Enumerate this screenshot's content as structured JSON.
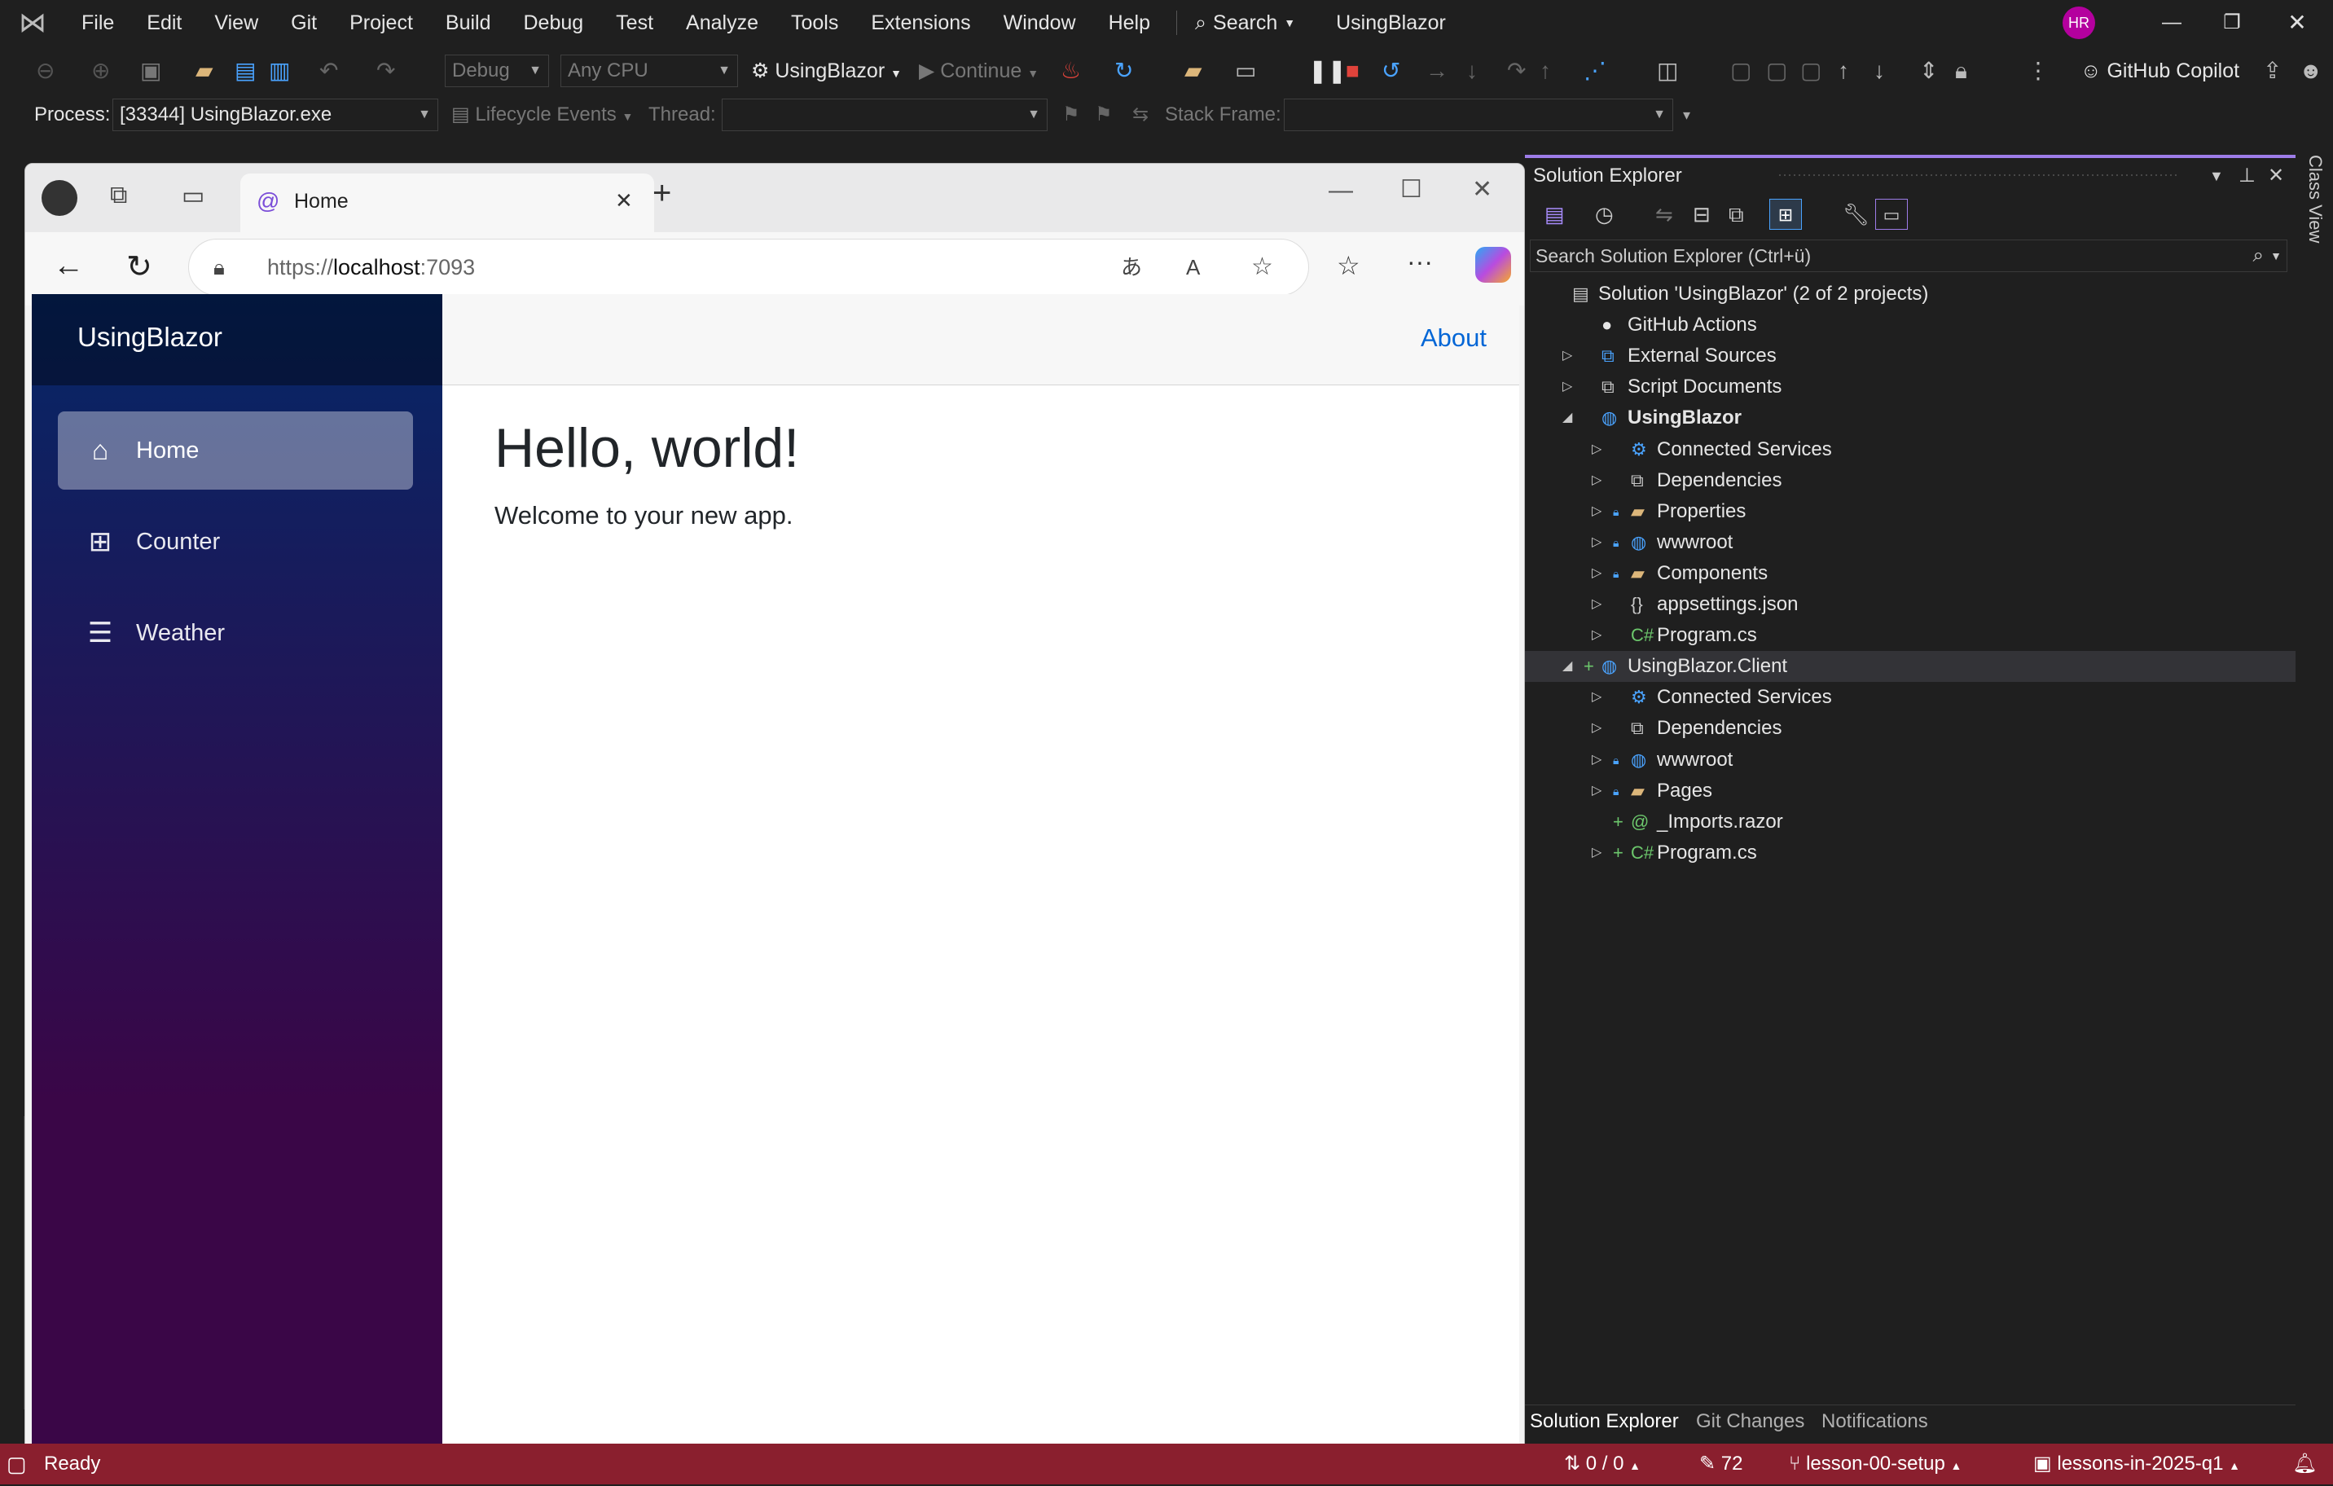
{
  "titlebar": {
    "menu": [
      "File",
      "Edit",
      "View",
      "Git",
      "Project",
      "Build",
      "Debug",
      "Test",
      "Analyze",
      "Tools",
      "Extensions",
      "Window",
      "Help"
    ],
    "search_label": "Search",
    "solution_title": "UsingBlazor",
    "avatar_initials": "HR"
  },
  "toolbar": {
    "config": "Debug",
    "platform": "Any CPU",
    "startup": "UsingBlazor",
    "continue": "Continue",
    "copilot": "GitHub Copilot"
  },
  "toolbar2": {
    "process_label": "Process:",
    "process_value": "[33344] UsingBlazor.exe",
    "lifecycle": "Lifecycle Events",
    "thread_label": "Thread:",
    "stackframe_label": "Stack Frame:"
  },
  "browser": {
    "tab_title": "Home",
    "url_prefix": "https://",
    "url_host": "localhost",
    "url_port": ":7093"
  },
  "app": {
    "brand": "UsingBlazor",
    "about": "About",
    "nav": [
      "Home",
      "Counter",
      "Weather"
    ],
    "heading": "Hello, world!",
    "welcome": "Welcome to your new app."
  },
  "solution_explorer": {
    "title": "Solution Explorer",
    "search_placeholder": "Search Solution Explorer (Ctrl+ü)",
    "side_tab": "Class View",
    "rows": [
      {
        "label": "Solution 'UsingBlazor' (2 of 2 projects)",
        "level": 0,
        "expander": "none",
        "icon": "solution-icon",
        "bold": false
      },
      {
        "label": "GitHub Actions",
        "level": 1,
        "expander": "none",
        "icon": "github-icon",
        "bold": false
      },
      {
        "label": "External Sources",
        "level": 1,
        "expander": "collapsed",
        "icon": "external-sources-icon",
        "bold": false
      },
      {
        "label": "Script Documents",
        "level": 1,
        "expander": "collapsed",
        "icon": "script-icon",
        "bold": false
      },
      {
        "label": "UsingBlazor",
        "level": 1,
        "expander": "expanded",
        "icon": "web-project-icon",
        "bold": true
      },
      {
        "label": "Connected Services",
        "level": 2,
        "expander": "collapsed",
        "icon": "connected-services-icon",
        "bold": false
      },
      {
        "label": "Dependencies",
        "level": 2,
        "expander": "collapsed",
        "icon": "dependencies-icon",
        "bold": false
      },
      {
        "label": "Properties",
        "level": 2,
        "expander": "collapsed",
        "icon": "properties-icon",
        "bold": false,
        "lock": true
      },
      {
        "label": "wwwroot",
        "level": 2,
        "expander": "collapsed",
        "icon": "globe-icon",
        "bold": false,
        "lock": true
      },
      {
        "label": "Components",
        "level": 2,
        "expander": "collapsed",
        "icon": "folder-icon",
        "bold": false,
        "lock": true
      },
      {
        "label": "appsettings.json",
        "level": 2,
        "expander": "collapsed",
        "icon": "json-icon",
        "bold": false
      },
      {
        "label": "Program.cs",
        "level": 2,
        "expander": "collapsed",
        "icon": "csharp-icon",
        "bold": false
      },
      {
        "label": "UsingBlazor.Client",
        "level": 1,
        "expander": "expanded",
        "icon": "web-project-icon",
        "bold": false,
        "plus": true,
        "selected": true
      },
      {
        "label": "Connected Services",
        "level": 2,
        "expander": "collapsed",
        "icon": "connected-services-icon",
        "bold": false
      },
      {
        "label": "Dependencies",
        "level": 2,
        "expander": "collapsed",
        "icon": "dependencies-icon",
        "bold": false
      },
      {
        "label": "wwwroot",
        "level": 2,
        "expander": "collapsed",
        "icon": "globe-icon",
        "bold": false,
        "lock": true
      },
      {
        "label": "Pages",
        "level": 2,
        "expander": "collapsed",
        "icon": "folder-icon",
        "bold": false,
        "lock": true
      },
      {
        "label": "_Imports.razor",
        "level": 2,
        "expander": "none",
        "icon": "razor-icon",
        "bold": false,
        "plus": true
      },
      {
        "label": "Program.cs",
        "level": 2,
        "expander": "collapsed",
        "icon": "csharp-icon",
        "bold": false,
        "plus": true
      }
    ],
    "bottom_tabs": [
      "Solution Explorer",
      "Git Changes",
      "Notifications"
    ]
  },
  "statusbar": {
    "ready": "Ready",
    "updown": "0 / 0",
    "edits": "72",
    "branch": "lesson-00-setup",
    "repo": "lessons-in-2025-q1",
    "notif": "1"
  }
}
